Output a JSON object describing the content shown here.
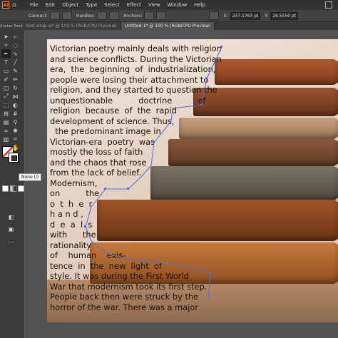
{
  "app": {
    "logo": "Ai"
  },
  "menu": [
    "File",
    "Edit",
    "Object",
    "Type",
    "Select",
    "Effect",
    "View",
    "Window",
    "Help"
  ],
  "control_bar": {
    "connect_label": "Connect:",
    "handles_label": "Handles:",
    "anchors_label": "Anchors:",
    "x_value": "237.1763 pt",
    "y_value": "26.5559 pt"
  },
  "option_sidebar": {
    "label": "Anchor Point"
  },
  "tabs": [
    {
      "label": "text wrap.ai* @ 100 % (RGB/CPU Preview)",
      "active": false
    },
    {
      "label": "Untitled-1* @ 100 % (RGB/CPU Preview)",
      "active": true
    }
  ],
  "tooltip": "None (/)",
  "text_lines": [
    "Victorian poetry mainly deals with religion",
    "and science conflicts. During the Victorian",
    "era,  the  beginning  of  industrialization,",
    "people were losing their attachment to",
    "religion, and they started to question the",
    "unquestionable          doctrine          of",
    "religion  because  of  the  rapid",
    "development of science. Thus,",
    "  the predominant image in",
    "Victorian-era  poetry  was",
    "mostly the loss of faith",
    "and the chaos that rose",
    "from the lack of belief.",
    "Modernism,",
    "on          the",
    "o  t  h  e  r",
    "h a n d ,",
    "d  e  a  l  s",
    "with      the",
    "rationality",
    "of    human    exis-",
    "tence  in  the  new  light  of",
    "style. It was during the First World",
    "War that modernism took its first step.",
    "People back then were struck by the",
    "horror of the war. There was a major"
  ],
  "colors": {
    "ui_dark": "#323232",
    "canvas": "#535353",
    "selection": "#4f6fd6",
    "fill_none": "#ffffff"
  }
}
